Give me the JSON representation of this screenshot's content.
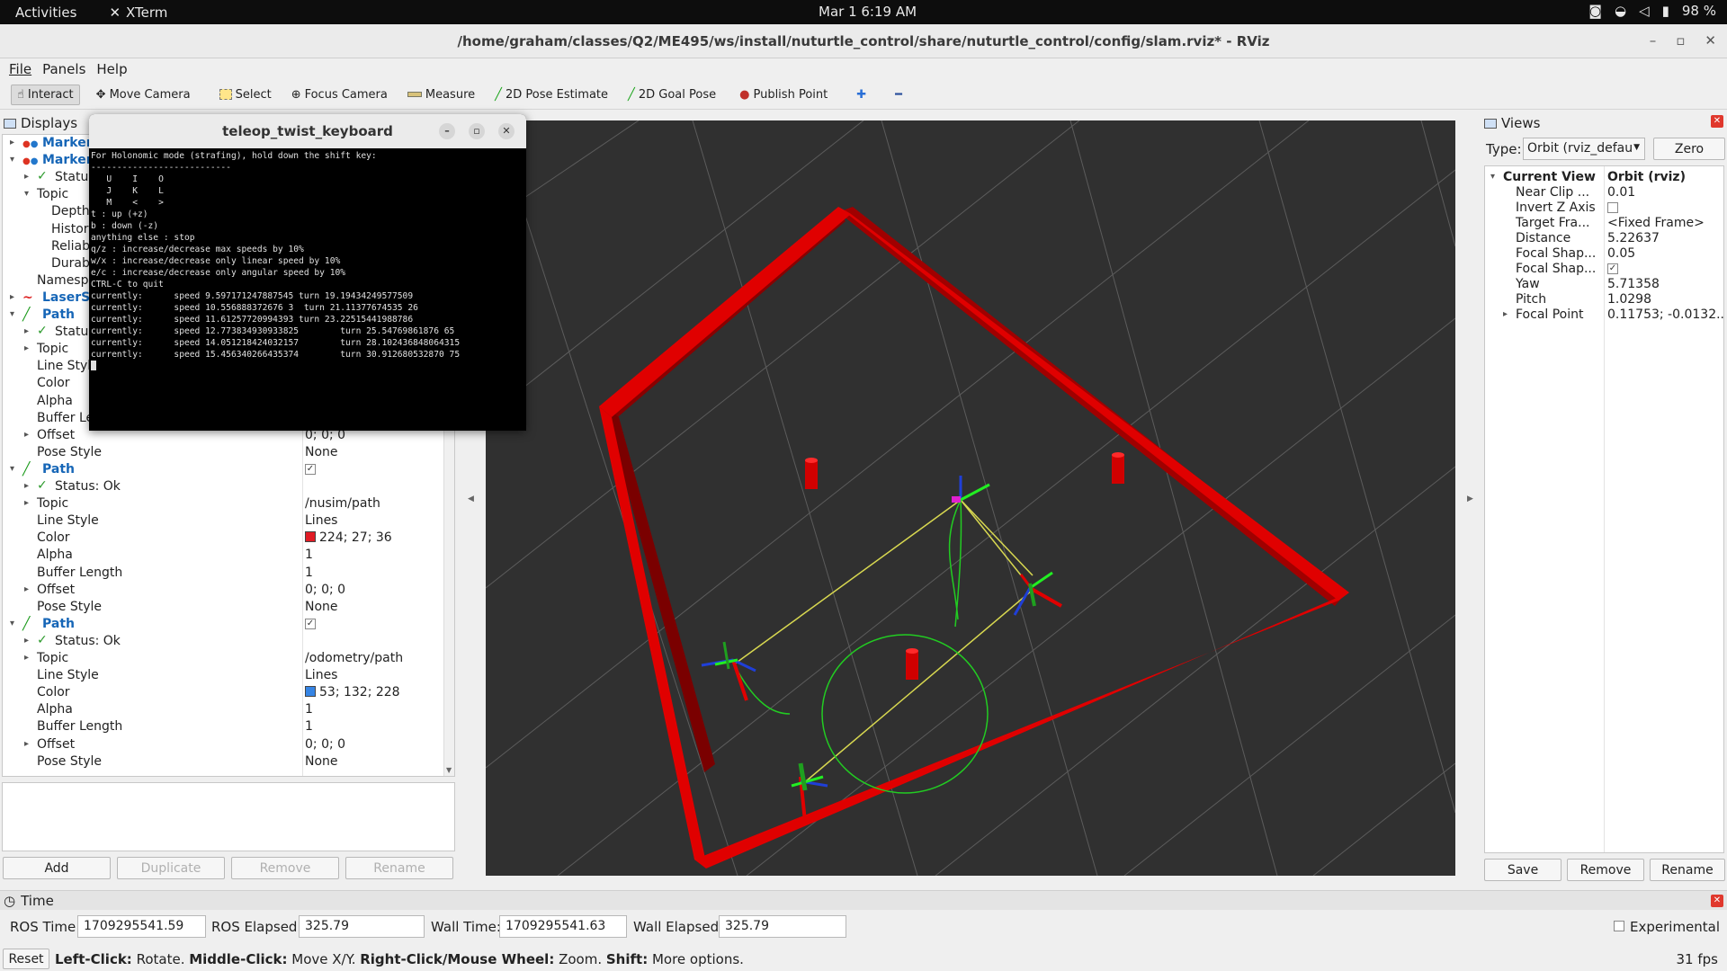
{
  "topbar": {
    "activities": "Activities",
    "app_name": "XTerm",
    "datetime": "Mar 1  6:19 AM",
    "battery": "98 %"
  },
  "window": {
    "title": "/home/graham/classes/Q2/ME495/ws/install/nuturtle_control/share/nuturtle_control/config/slam.rviz* - RViz"
  },
  "menu": [
    "File",
    "Panels",
    "Help"
  ],
  "toolbar": {
    "interact": "Interact",
    "move_camera": "Move Camera",
    "select": "Select",
    "focus_camera": "Focus Camera",
    "measure": "Measure",
    "pose_estimate": "2D Pose Estimate",
    "goal_pose": "2D Goal Pose",
    "publish_point": "Publish Point"
  },
  "displays": {
    "title": "Displays",
    "rows": [
      {
        "label": "Marker",
        "value": "",
        "indent": 0,
        "arrow": "▸",
        "style": "blue",
        "icon": "marker"
      },
      {
        "label": "Marker",
        "value": "",
        "indent": 0,
        "arrow": "▾",
        "style": "blue",
        "icon": "marker"
      },
      {
        "label": "Status",
        "value": "",
        "indent": 1,
        "arrow": "▸",
        "style": "check"
      },
      {
        "label": "Topic",
        "value": "",
        "indent": 1,
        "arrow": "▾",
        "style": ""
      },
      {
        "label": "Depth",
        "value": "",
        "indent": 2,
        "arrow": "",
        "style": ""
      },
      {
        "label": "History",
        "value": "",
        "indent": 2,
        "arrow": "",
        "style": ""
      },
      {
        "label": "Reliability",
        "value": "",
        "indent": 2,
        "arrow": "",
        "style": ""
      },
      {
        "label": "Durability",
        "value": "",
        "indent": 2,
        "arrow": "",
        "style": ""
      },
      {
        "label": "Namespaces",
        "value": "",
        "indent": 1,
        "arrow": "",
        "style": ""
      },
      {
        "label": "LaserScan",
        "value": "",
        "indent": 0,
        "arrow": "▸",
        "style": "blue",
        "icon": "laser"
      },
      {
        "label": "Path",
        "value": "",
        "indent": 0,
        "arrow": "▾",
        "style": "blue",
        "icon": "path"
      },
      {
        "label": "Status",
        "value": "",
        "indent": 1,
        "arrow": "▸",
        "style": "check"
      },
      {
        "label": "Topic",
        "value": "",
        "indent": 1,
        "arrow": "▸",
        "style": ""
      },
      {
        "label": "Line Style",
        "value": "",
        "indent": 1,
        "arrow": "",
        "style": ""
      },
      {
        "label": "Color",
        "value": "",
        "indent": 1,
        "arrow": "",
        "style": ""
      },
      {
        "label": "Alpha",
        "value": "",
        "indent": 1,
        "arrow": "",
        "style": ""
      },
      {
        "label": "Buffer Length",
        "value": "",
        "indent": 1,
        "arrow": "",
        "style": ""
      },
      {
        "label": "Offset",
        "value": "0; 0; 0",
        "indent": 1,
        "arrow": "▸",
        "style": ""
      },
      {
        "label": "Pose Style",
        "value": "None",
        "indent": 1,
        "arrow": "",
        "style": ""
      },
      {
        "label": "Path",
        "value": "",
        "indent": 0,
        "arrow": "▾",
        "style": "blue",
        "icon": "path",
        "checkbox": true
      },
      {
        "label": "Status: Ok",
        "value": "",
        "indent": 1,
        "arrow": "▸",
        "style": "check"
      },
      {
        "label": "Topic",
        "value": "/nusim/path",
        "indent": 1,
        "arrow": "▸",
        "style": ""
      },
      {
        "label": "Line Style",
        "value": "Lines",
        "indent": 1,
        "arrow": "",
        "style": ""
      },
      {
        "label": "Color",
        "value": "224; 27; 36",
        "indent": 1,
        "arrow": "",
        "style": "",
        "swatch": "#e01b24"
      },
      {
        "label": "Alpha",
        "value": "1",
        "indent": 1,
        "arrow": "",
        "style": ""
      },
      {
        "label": "Buffer Length",
        "value": "1",
        "indent": 1,
        "arrow": "",
        "style": ""
      },
      {
        "label": "Offset",
        "value": "0; 0; 0",
        "indent": 1,
        "arrow": "▸",
        "style": ""
      },
      {
        "label": "Pose Style",
        "value": "None",
        "indent": 1,
        "arrow": "",
        "style": ""
      },
      {
        "label": "Path",
        "value": "",
        "indent": 0,
        "arrow": "▾",
        "style": "blue",
        "icon": "path",
        "checkbox": true
      },
      {
        "label": "Status: Ok",
        "value": "",
        "indent": 1,
        "arrow": "▸",
        "style": "check"
      },
      {
        "label": "Topic",
        "value": "/odometry/path",
        "indent": 1,
        "arrow": "▸",
        "style": ""
      },
      {
        "label": "Line Style",
        "value": "Lines",
        "indent": 1,
        "arrow": "",
        "style": ""
      },
      {
        "label": "Color",
        "value": "53; 132; 228",
        "indent": 1,
        "arrow": "",
        "style": "",
        "swatch": "#3584e4"
      },
      {
        "label": "Alpha",
        "value": "1",
        "indent": 1,
        "arrow": "",
        "style": ""
      },
      {
        "label": "Buffer Length",
        "value": "1",
        "indent": 1,
        "arrow": "",
        "style": ""
      },
      {
        "label": "Offset",
        "value": "0; 0; 0",
        "indent": 1,
        "arrow": "▸",
        "style": ""
      },
      {
        "label": "Pose Style",
        "value": "None",
        "indent": 1,
        "arrow": "",
        "style": ""
      }
    ],
    "buttons": {
      "add": "Add",
      "duplicate": "Duplicate",
      "remove": "Remove",
      "rename": "Rename"
    }
  },
  "views": {
    "title": "Views",
    "type_label": "Type:",
    "type_value": "Orbit (rviz_defau",
    "zero": "Zero",
    "rows": [
      {
        "label": "Current View",
        "value": "Orbit (rviz)",
        "bold": true,
        "arrow": "▾",
        "indent": 0
      },
      {
        "label": "Near Clip ...",
        "value": "0.01",
        "indent": 1
      },
      {
        "label": "Invert Z Axis",
        "value": "",
        "indent": 1,
        "checkbox": "empty"
      },
      {
        "label": "Target Fra...",
        "value": "<Fixed Frame>",
        "indent": 1
      },
      {
        "label": "Distance",
        "value": "5.22637",
        "indent": 1
      },
      {
        "label": "Focal Shap...",
        "value": "0.05",
        "indent": 1
      },
      {
        "label": "Focal Shap...",
        "value": "",
        "indent": 1,
        "checkbox": "checked"
      },
      {
        "label": "Yaw",
        "value": "5.71358",
        "indent": 1
      },
      {
        "label": "Pitch",
        "value": "1.0298",
        "indent": 1
      },
      {
        "label": "Focal Point",
        "value": "0.11753; -0.0132...",
        "indent": 1,
        "arrow": "▸"
      }
    ],
    "buttons": {
      "save": "Save",
      "remove": "Remove",
      "rename": "Rename"
    }
  },
  "time": {
    "title": "Time",
    "ros_time_label": "ROS Time:",
    "ros_time": "1709295541.59",
    "ros_elapsed_label": "ROS Elapsed:",
    "ros_elapsed": "325.79",
    "wall_time_label": "Wall Time:",
    "wall_time": "1709295541.63",
    "wall_elapsed_label": "Wall Elapsed:",
    "wall_elapsed": "325.79",
    "experimental": "Experimental"
  },
  "status": {
    "reset": "Reset",
    "l1": "Left-Click:",
    "t1": " Rotate. ",
    "l2": "Middle-Click:",
    "t2": " Move X/Y. ",
    "l3": "Right-Click/Mouse Wheel:",
    "t3": " Zoom. ",
    "l4": "Shift:",
    "t4": " More options.",
    "fps": "31 fps"
  },
  "terminal": {
    "title": "teleop_twist_keyboard",
    "lines": [
      "For Holonomic mode (strafing), hold down the shift key:",
      "---------------------------",
      "   U    I    O",
      "   J    K    L",
      "   M    <    >",
      "",
      "t : up (+z)",
      "b : down (-z)",
      "",
      "anything else : stop",
      "",
      "q/z : increase/decrease max speeds by 10%",
      "w/x : increase/decrease only linear speed by 10%",
      "e/c : increase/decrease only angular speed by 10%",
      "",
      "CTRL-C to quit",
      "",
      "currently:      speed 9.597171247887545 turn 19.19434249577509",
      "currently:      speed 10.556888372676 3  turn 21.11377674535 26",
      "currently:      speed 11.61257720994393 turn 23.22515441988786",
      "currently:      speed 12.773834930933825        turn 25.54769861876 65",
      "currently:      speed 14.051218424032157        turn 28.102436848064315",
      "currently:      speed 15.456340266435374        turn 30.912680532870 75"
    ]
  },
  "colors": {
    "wall": "#e00000",
    "grid": "#5a5a5a",
    "path_green": "#22cc22",
    "ray_yellow": "#d8d850",
    "background": "#303030"
  }
}
